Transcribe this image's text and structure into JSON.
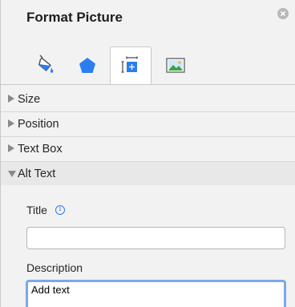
{
  "pane": {
    "title": "Format Picture",
    "tabs": [
      {
        "name": "fill-and-line",
        "icon": "paint-bucket-icon",
        "active": false
      },
      {
        "name": "effects",
        "icon": "pentagon-icon",
        "active": false
      },
      {
        "name": "size-and-properties",
        "icon": "layout-properties-icon",
        "active": true
      },
      {
        "name": "picture",
        "icon": "image-icon",
        "active": false
      }
    ],
    "sections": {
      "size": "Size",
      "position": "Position",
      "text_box": "Text Box",
      "alt_text": "Alt Text"
    },
    "alt_text": {
      "title_label": "Title",
      "title_value": "",
      "description_label": "Description",
      "description_value": "Add text"
    }
  },
  "colors": {
    "accent": "#2a7ef0",
    "focus_ring": "#7aa8ec"
  }
}
